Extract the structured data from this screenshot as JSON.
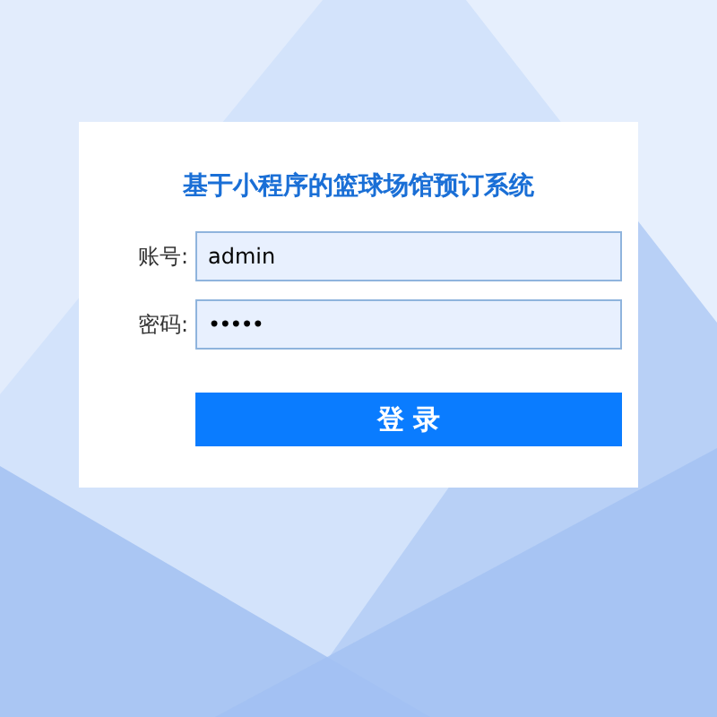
{
  "title": "基于小程序的篮球场馆预订系统",
  "fields": [
    {
      "label": "账号:",
      "value": "admin",
      "kind": "text"
    },
    {
      "label": "密码:",
      "value": "•••••",
      "kind": "password"
    }
  ],
  "login_button": "登 录"
}
